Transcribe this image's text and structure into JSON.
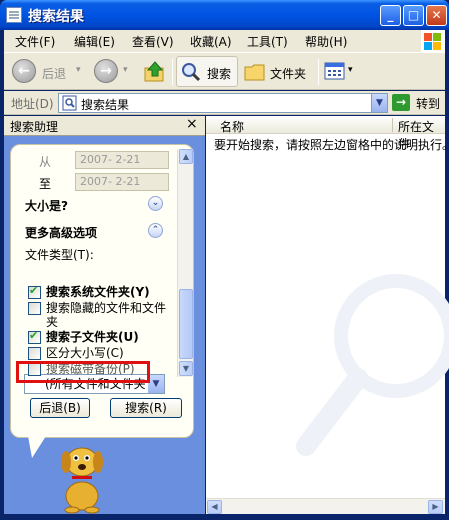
{
  "window": {
    "title": "搜索结果"
  },
  "titlebar_buttons": {
    "minimize": "_",
    "maximize": "□",
    "close": "✕"
  },
  "menu": [
    "文件(F)",
    "编辑(E)",
    "查看(V)",
    "收藏(A)",
    "工具(T)",
    "帮助(H)"
  ],
  "toolbar": {
    "back_label": "后退",
    "search_label": "搜索",
    "folders_label": "文件夹"
  },
  "address": {
    "label": "地址(D)",
    "value": "搜索结果",
    "go_label": "转到"
  },
  "left_pane": {
    "title": "搜索助理",
    "close_glyph": "×",
    "from_label": "从",
    "from_date": "2007- 2-21",
    "to_label": "至",
    "to_date": "2007- 2-21",
    "size_section": "大小是?",
    "advanced_section": "更多高级选项",
    "file_type_label": "文件类型(T):",
    "file_type_value": "(所有文件和文件夹",
    "options": [
      {
        "label": "搜索系统文件夹(Y)",
        "checked": true,
        "bold": true
      },
      {
        "label": "搜索隐藏的文件和文件夹",
        "checked": false,
        "bold": false
      },
      {
        "label": "搜索子文件夹(U)",
        "checked": true,
        "bold": true
      },
      {
        "label": "区分大小写(C)",
        "checked": false,
        "bold": false
      },
      {
        "label": "搜索磁带备份(P)",
        "checked": false,
        "bold": false
      }
    ],
    "back_button": "后退(B)",
    "search_button": "搜索(R)"
  },
  "results": {
    "columns": [
      "名称",
      "所在文件"
    ],
    "message": "要开始搜索，请按照左边窗格中的说明执行。"
  },
  "colors": {
    "titlebar": "#0054e3",
    "pane": "#6b8fdf",
    "highlight": "#e01010"
  }
}
